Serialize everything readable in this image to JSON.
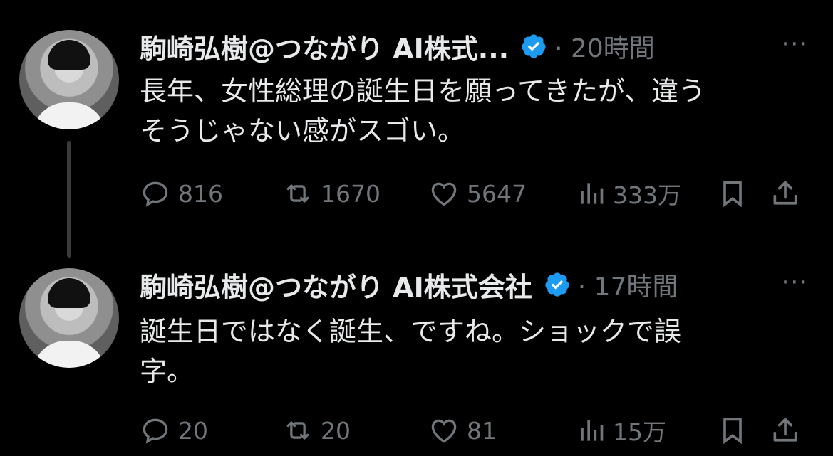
{
  "tweets": [
    {
      "author": "駒崎弘樹@つながり AI株式...",
      "timestamp": "· 20時間",
      "more": "···",
      "text": "長年、女性総理の誕生日を願ってきたが、違う\nそうじゃない感がスゴい。",
      "replies": "816",
      "retweets": "1670",
      "likes": "5647",
      "views": "333万"
    },
    {
      "author": "駒崎弘樹@つながり AI株式会社",
      "timestamp": "· 17時間",
      "more": "···",
      "text": "誕生日ではなく誕生、ですね。ショックで誤\n字。",
      "replies": "20",
      "retweets": "20",
      "likes": "81",
      "views": "15万"
    }
  ],
  "colors": {
    "background": "#000000",
    "text": "#e7e9ea",
    "muted": "#71767b",
    "verified": "#1d9bf0"
  },
  "icons": [
    "reply-icon",
    "retweet-icon",
    "like-icon",
    "views-icon",
    "bookmark-icon",
    "share-icon",
    "verified-badge-icon"
  ]
}
